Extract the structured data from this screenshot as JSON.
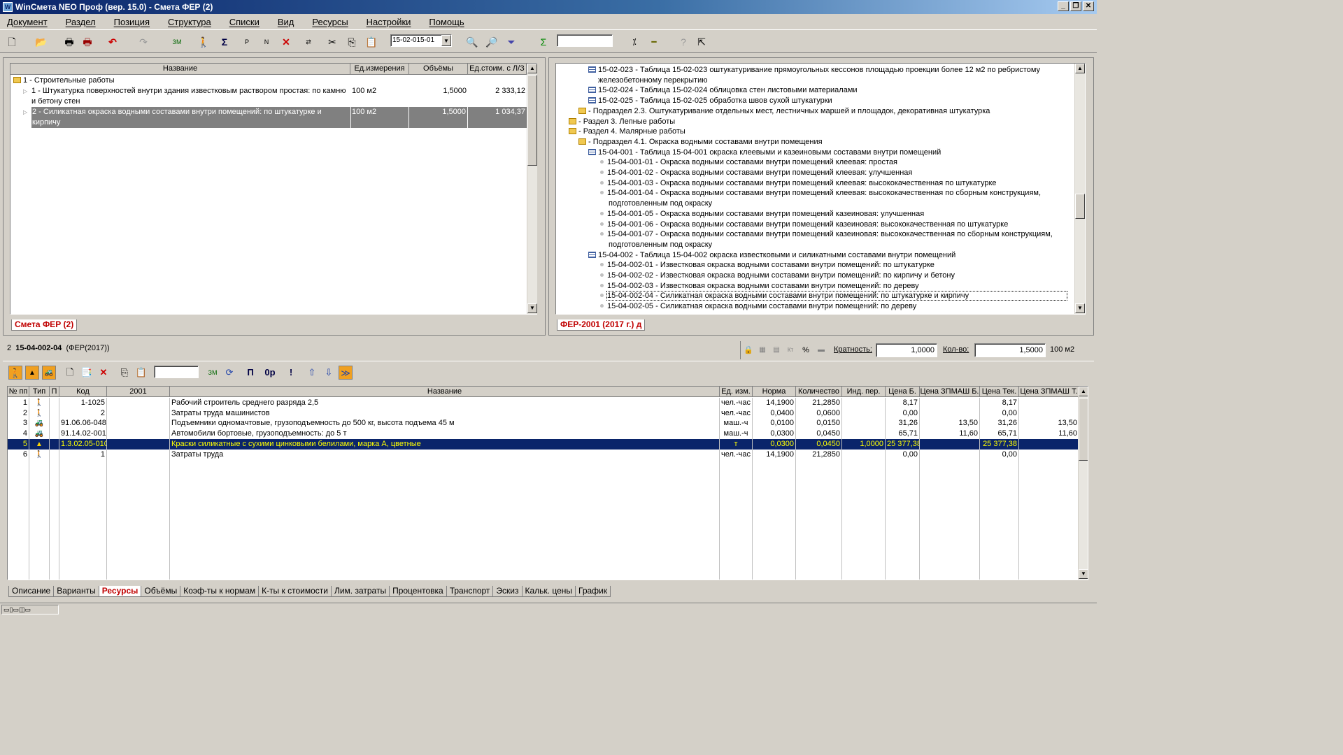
{
  "window": {
    "title": "WinСмета NEO Проф (вер. 15.0) - Смета ФЕР (2)"
  },
  "menu": [
    "Документ",
    "Раздел",
    "Позиция",
    "Структура",
    "Списки",
    "Вид",
    "Ресурсы",
    "Настройки",
    "Помощь"
  ],
  "toolbar": {
    "code_value": "15-02-015-01",
    "search_value": ""
  },
  "estimate": {
    "columns": [
      "Название",
      "Ед.измерения",
      "Объёмы",
      "Ед.стоим. с Л/З"
    ],
    "section": "1 - Строительные работы",
    "rows": [
      {
        "name": "1 - Штукатурка поверхностей внутри здания известковым раствором простая: по камню и бетону стен",
        "unit": "100 м2",
        "qty": "1,5000",
        "cost": "2 333,12"
      },
      {
        "name": "2 - Силикатная окраска водными составами внутри помещений: по штукатурке и кирпичу",
        "unit": "100 м2",
        "qty": "1,5000",
        "cost": "1 034,37"
      }
    ],
    "tab": "Смета ФЕР (2)"
  },
  "reference": {
    "tab": "ФЕР-2001 (2017 г.) д",
    "lines": [
      {
        "indent": 3,
        "icon": "table",
        "text": "15-02-023 - Таблица 15-02-023 оштукатуривание прямоугольных кессонов площадью проекции более 12 м2 по ребристому"
      },
      {
        "indent": 3,
        "icon": "none",
        "text": "железобетонному перекрытию"
      },
      {
        "indent": 3,
        "icon": "table",
        "text": "15-02-024 - Таблица 15-02-024 облицовка стен листовыми материалами"
      },
      {
        "indent": 3,
        "icon": "table",
        "text": "15-02-025 - Таблица 15-02-025 обработка швов сухой штукатурки"
      },
      {
        "indent": 2,
        "icon": "folder",
        "text": "- Подраздел 2.3. Оштукатуривание отдельных мест, лестничных маршей и площадок, декоративная штукатурка"
      },
      {
        "indent": 1,
        "icon": "folder",
        "text": "- Раздел 3. Лепные работы"
      },
      {
        "indent": 1,
        "icon": "folder",
        "text": "- Раздел 4. Малярные работы"
      },
      {
        "indent": 2,
        "icon": "folder",
        "text": "- Подраздел 4.1. Окраска водными составами внутри помещения"
      },
      {
        "indent": 3,
        "icon": "table",
        "text": "15-04-001 - Таблица 15-04-001 окраска клеевыми и казеиновыми составами внутри помещений"
      },
      {
        "indent": 4,
        "icon": "dot",
        "text": "15-04-001-01 - Окраска водными составами внутри помещений клеевая: простая"
      },
      {
        "indent": 4,
        "icon": "dot",
        "text": "15-04-001-02 - Окраска водными составами внутри помещений клеевая: улучшенная"
      },
      {
        "indent": 4,
        "icon": "dot",
        "text": "15-04-001-03 - Окраска водными составами внутри помещений клеевая: высококачественная по штукатурке"
      },
      {
        "indent": 4,
        "icon": "dot",
        "text": "15-04-001-04 - Окраска водными составами внутри помещений клеевая: высококачественная по сборным конструкциям,"
      },
      {
        "indent": 4,
        "icon": "none",
        "text": "подготовленным под окраску"
      },
      {
        "indent": 4,
        "icon": "dot",
        "text": "15-04-001-05 - Окраска водными составами внутри помещений казеиновая: улучшенная"
      },
      {
        "indent": 4,
        "icon": "dot",
        "text": "15-04-001-06 - Окраска водными составами внутри помещений казеиновая: высококачественная по штукатурке"
      },
      {
        "indent": 4,
        "icon": "dot",
        "text": "15-04-001-07 - Окраска водными составами внутри помещений казеиновая: высококачественная по сборным конструкциям,"
      },
      {
        "indent": 4,
        "icon": "none",
        "text": "подготовленным под окраску"
      },
      {
        "indent": 3,
        "icon": "table",
        "text": "15-04-002 - Таблица 15-04-002 окраска известковыми и силикатными составами внутри помещений"
      },
      {
        "indent": 4,
        "icon": "dot",
        "text": "15-04-002-01 - Известковая окраска водными составами внутри помещений: по штукатурке"
      },
      {
        "indent": 4,
        "icon": "dot",
        "text": "15-04-002-02 - Известковая окраска водными составами внутри помещений: по кирпичу и бетону"
      },
      {
        "indent": 4,
        "icon": "dot",
        "text": "15-04-002-03 - Известковая окраска водными составами внутри помещений: по дереву"
      },
      {
        "indent": 4,
        "icon": "dot",
        "text": "15-04-002-04 - Силикатная окраска водными составами внутри помещений: по штукатурке и кирпичу",
        "focused": true
      },
      {
        "indent": 4,
        "icon": "dot",
        "text": "15-04-002-05 - Силикатная окраска водными составами внутри помещений: по дереву"
      }
    ]
  },
  "position": {
    "num": "2",
    "code": "15-04-002-04",
    "base": "(ФЕР(2017))",
    "ratio_label": "Кратность:",
    "ratio_value": "1,0000",
    "qty_label": "Кол-во:",
    "qty_value": "1,5000",
    "unit": "100 м2"
  },
  "resources": {
    "columns": [
      "№ пп",
      "Тип",
      "П",
      "Код",
      "2001",
      "Название",
      "Ед. изм.",
      "Норма",
      "Количество",
      "Инд. пер.",
      "Цена Б.",
      "Цена ЗПМАШ Б.",
      "Цена Тек.",
      "Цена ЗПМАШ Т."
    ],
    "rows": [
      {
        "n": "1",
        "type": "worker",
        "code": "1-1025",
        "name": "Рабочий строитель среднего разряда 2,5",
        "unit": "чел.-час",
        "norm": "14,1900",
        "qty": "21,2850",
        "idx": "",
        "pb": "8,17",
        "zb": "",
        "pt": "8,17",
        "zt": ""
      },
      {
        "n": "2",
        "type": "worker",
        "code": "2",
        "name": "Затраты труда машинистов",
        "unit": "чел.-час",
        "norm": "0,0400",
        "qty": "0,0600",
        "idx": "",
        "pb": "0,00",
        "zb": "",
        "pt": "0,00",
        "zt": ""
      },
      {
        "n": "3",
        "type": "machine",
        "code": "91.06.06-048",
        "name": "Подъемники одномачтовые, грузоподъемность до 500 кг, высота подъема 45 м",
        "unit": "маш.-ч",
        "norm": "0,0100",
        "qty": "0,0150",
        "idx": "",
        "pb": "31,26",
        "zb": "13,50",
        "pt": "31,26",
        "zt": "13,50"
      },
      {
        "n": "4",
        "type": "machine",
        "code": "91.14.02-001",
        "name": "Автомобили бортовые, грузоподъемность: до 5 т",
        "unit": "маш.-ч",
        "norm": "0,0300",
        "qty": "0,0450",
        "idx": "",
        "pb": "65,71",
        "zb": "11,60",
        "pt": "65,71",
        "zt": "11,60"
      },
      {
        "n": "5",
        "type": "material",
        "code": "1.3.02.05-0104",
        "name": "Краски силикатные с сухими цинковыми белилами, марка А, цветные",
        "unit": "т",
        "norm": "0,0300",
        "qty": "0,0450",
        "idx": "1,0000",
        "pb": "25 377,38",
        "zb": "",
        "pt": "25 377,38",
        "zt": "",
        "selected": true
      },
      {
        "n": "6",
        "type": "worker",
        "code": "1",
        "name": "Затраты труда",
        "unit": "чел.-час",
        "norm": "14,1900",
        "qty": "21,2850",
        "idx": "",
        "pb": "0,00",
        "zb": "",
        "pt": "0,00",
        "zt": ""
      }
    ]
  },
  "bottom_tabs": [
    "Описание",
    "Варианты",
    "Ресурсы",
    "Объёмы",
    "Коэф-ты к нормам",
    "К-ты к стоимости",
    "Лим. затраты",
    "Процентовка",
    "Транспорт",
    "Эскиз",
    "Кальк. цены",
    "График"
  ],
  "active_bottom_tab": "Ресурсы",
  "colors": {
    "selection": "#0a246a",
    "selection_text": "#ffff00",
    "tab_active": "#c00000",
    "row_gray": "#808080"
  }
}
